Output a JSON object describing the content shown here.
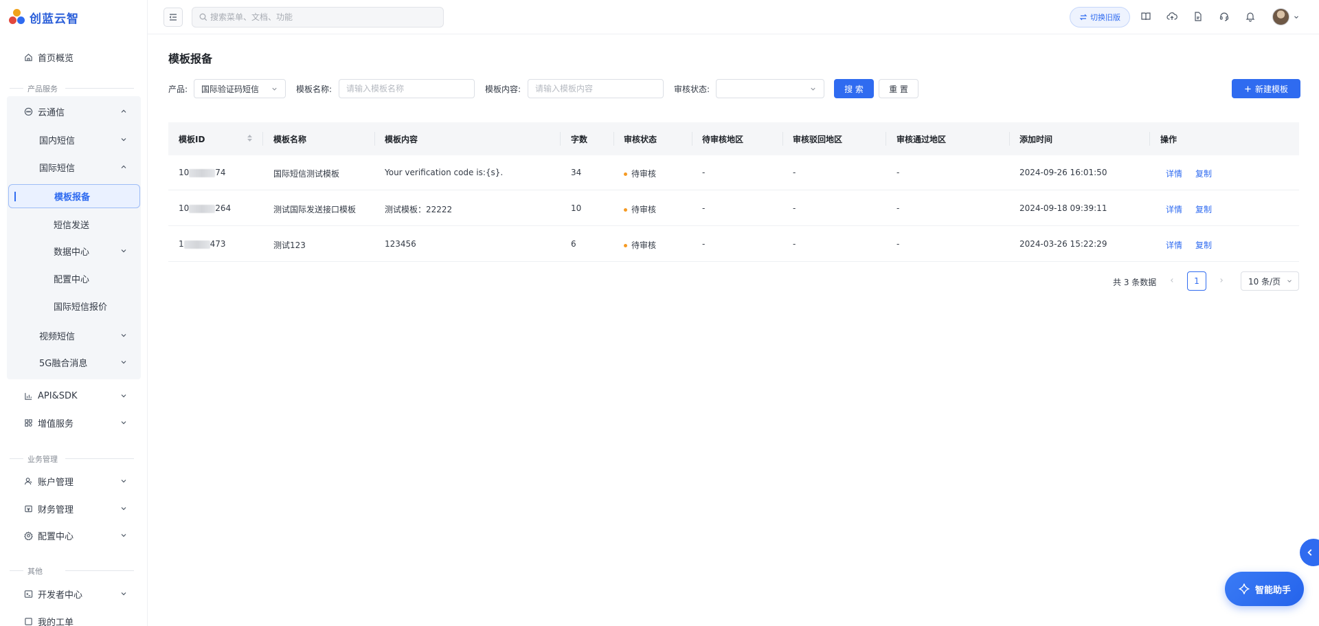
{
  "brand": {
    "name": "创蓝云智"
  },
  "sidebar": {
    "home": "首页概览",
    "section_product": "产品服务",
    "cloud_msg": "云通信",
    "domestic_sms": "国内短信",
    "intl_sms": "国际短信",
    "intl_children": [
      "模板报备",
      "短信发送",
      "数据中心",
      "配置中心",
      "国际短信报价"
    ],
    "video_sms": "视频短信",
    "fiveg": "5G融合消息",
    "api_sdk": "API&SDK",
    "value_added": "增值服务",
    "section_business": "业务管理",
    "account": "账户管理",
    "finance": "财务管理",
    "config": "配置中心",
    "section_other": "其他",
    "developer": "开发者中心",
    "cut_off": "我的工单"
  },
  "header": {
    "search_placeholder": "搜索菜单、文档、功能",
    "switch_old": "切换旧版"
  },
  "page": {
    "title": "模板报备"
  },
  "filters": {
    "product_label": "产品:",
    "product_value": "国际验证码短信",
    "name_label": "模板名称:",
    "name_placeholder": "请输入模板名称",
    "content_label": "模板内容:",
    "content_placeholder": "请输入模板内容",
    "status_label": "审核状态:",
    "status_value": "",
    "search_btn": "搜 索",
    "reset_btn": "重 置",
    "new_btn": "新建模板"
  },
  "table": {
    "headers": [
      "模板ID",
      "模板名称",
      "模板内容",
      "字数",
      "审核状态",
      "待审核地区",
      "审核驳回地区",
      "审核通过地区",
      "添加时间",
      "操作"
    ],
    "rows": [
      {
        "id_pre": "10",
        "id_post": "74",
        "name": "国际短信测试模板",
        "content": "Your verification code is:{s}.",
        "count": "34",
        "status": "待审核",
        "pending": "-",
        "rejected": "-",
        "approved": "-",
        "time": "2024-09-26 16:01:50",
        "op1": "详情",
        "op2": "复制"
      },
      {
        "id_pre": "10",
        "id_post": "264",
        "name": "测试国际发送接口模板",
        "content": "测试模板：22222",
        "count": "10",
        "status": "待审核",
        "pending": "-",
        "rejected": "-",
        "approved": "-",
        "time": "2024-09-18 09:39:11",
        "op1": "详情",
        "op2": "复制"
      },
      {
        "id_pre": "1",
        "id_post": "473",
        "name": "测试123",
        "content": "123456",
        "count": "6",
        "status": "待审核",
        "pending": "-",
        "rejected": "-",
        "approved": "-",
        "time": "2024-03-26 15:22:29",
        "op1": "详情",
        "op2": "复制"
      }
    ]
  },
  "pagination": {
    "total": "共 3 条数据",
    "current": "1",
    "page_size": "10 条/页"
  },
  "assistant": {
    "label": "智能助手"
  },
  "colors": {
    "primary": "#2f6bf0",
    "pending_dot": "#f59a23",
    "brand_text": "#2b5fd9"
  }
}
